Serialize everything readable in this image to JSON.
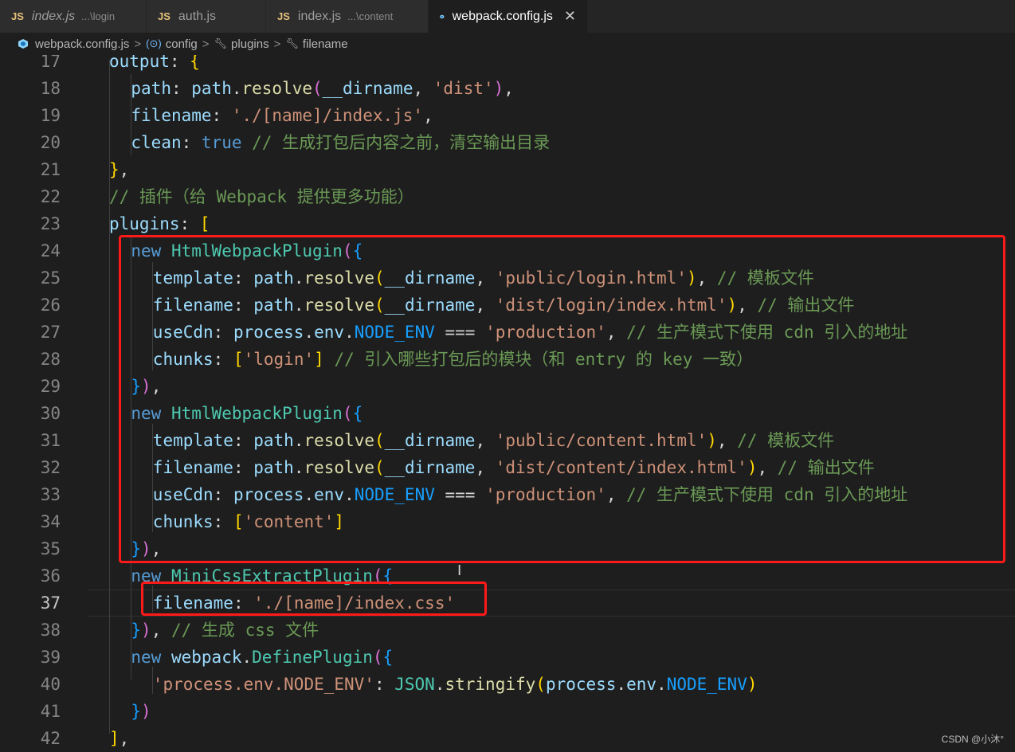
{
  "tabs": [
    {
      "name": "index.js",
      "hint": "...\\login",
      "italic": true
    },
    {
      "name": "auth.js",
      "hint": "",
      "italic": false
    },
    {
      "name": "index.js",
      "hint": "...\\content",
      "italic": false
    },
    {
      "name": "webpack.config.js",
      "hint": "",
      "italic": false,
      "active": true
    }
  ],
  "tab_badge": "JS",
  "close_glyph": "✕",
  "breadcrumb": [
    "webpack.config.js",
    "config",
    "plugins",
    "filename"
  ],
  "breadcrumb_sep": ">",
  "watermark": "CSDN @小沐°",
  "current_line": 37,
  "lines": [
    {
      "n": "17",
      "indent": 0,
      "t": [
        [
          "p",
          "output"
        ],
        [
          "pl",
          ": "
        ],
        [
          "b1",
          "{"
        ]
      ]
    },
    {
      "n": "18",
      "indent": 1,
      "t": [
        [
          "p",
          "path"
        ],
        [
          "pl",
          ": "
        ],
        [
          "p",
          "path"
        ],
        [
          "pl",
          "."
        ],
        [
          "f",
          "resolve"
        ],
        [
          "b2",
          "("
        ],
        [
          "p",
          "__dirname"
        ],
        [
          "pl",
          ", "
        ],
        [
          "s",
          "'dist'"
        ],
        [
          "b2",
          ")"
        ],
        [
          "pl",
          ","
        ]
      ]
    },
    {
      "n": "19",
      "indent": 1,
      "t": [
        [
          "p",
          "filename"
        ],
        [
          "pl",
          ": "
        ],
        [
          "s",
          "'./[name]/index.js'"
        ],
        [
          "pl",
          ","
        ]
      ]
    },
    {
      "n": "20",
      "indent": 1,
      "t": [
        [
          "p",
          "clean"
        ],
        [
          "pl",
          ": "
        ],
        [
          "k",
          "true"
        ],
        [
          "pl",
          " "
        ],
        [
          "cm",
          "// 生成打包后内容之前，清空输出目录"
        ]
      ]
    },
    {
      "n": "21",
      "indent": 0,
      "t": [
        [
          "b1",
          "}"
        ],
        [
          "pl",
          ","
        ]
      ]
    },
    {
      "n": "22",
      "indent": 0,
      "t": [
        [
          "cm",
          "// 插件（给 Webpack 提供更多功能）"
        ]
      ]
    },
    {
      "n": "23",
      "indent": 0,
      "t": [
        [
          "p",
          "plugins"
        ],
        [
          "pl",
          ": "
        ],
        [
          "b1",
          "["
        ]
      ]
    },
    {
      "n": "24",
      "indent": 1,
      "t": [
        [
          "k",
          "new"
        ],
        [
          "pl",
          " "
        ],
        [
          "c",
          "HtmlWebpackPlugin"
        ],
        [
          "b2",
          "("
        ],
        [
          "b3",
          "{"
        ]
      ]
    },
    {
      "n": "25",
      "indent": 2,
      "t": [
        [
          "p",
          "template"
        ],
        [
          "pl",
          ": "
        ],
        [
          "p",
          "path"
        ],
        [
          "pl",
          "."
        ],
        [
          "f",
          "resolve"
        ],
        [
          "b1",
          "("
        ],
        [
          "p",
          "__dirname"
        ],
        [
          "pl",
          ", "
        ],
        [
          "s",
          "'public/login.html'"
        ],
        [
          "b1",
          ")"
        ],
        [
          "pl",
          ", "
        ],
        [
          "cm",
          "// 模板文件"
        ]
      ]
    },
    {
      "n": "26",
      "indent": 2,
      "t": [
        [
          "p",
          "filename"
        ],
        [
          "pl",
          ": "
        ],
        [
          "p",
          "path"
        ],
        [
          "pl",
          "."
        ],
        [
          "f",
          "resolve"
        ],
        [
          "b1",
          "("
        ],
        [
          "p",
          "__dirname"
        ],
        [
          "pl",
          ", "
        ],
        [
          "s",
          "'dist/login/index.html'"
        ],
        [
          "b1",
          ")"
        ],
        [
          "pl",
          ", "
        ],
        [
          "cm",
          "// 输出文件"
        ]
      ]
    },
    {
      "n": "27",
      "indent": 2,
      "t": [
        [
          "p",
          "useCdn"
        ],
        [
          "pl",
          ": "
        ],
        [
          "p",
          "process"
        ],
        [
          "pl",
          "."
        ],
        [
          "p",
          "env"
        ],
        [
          "pl",
          "."
        ],
        [
          "b3",
          "NODE_ENV"
        ],
        [
          "pl",
          " === "
        ],
        [
          "s",
          "'production'"
        ],
        [
          "pl",
          ", "
        ],
        [
          "cm",
          "// 生产模式下使用 cdn 引入的地址"
        ]
      ]
    },
    {
      "n": "28",
      "indent": 2,
      "t": [
        [
          "p",
          "chunks"
        ],
        [
          "pl",
          ": "
        ],
        [
          "b1",
          "["
        ],
        [
          "s",
          "'login'"
        ],
        [
          "b1",
          "]"
        ],
        [
          "pl",
          " "
        ],
        [
          "cm",
          "// 引入哪些打包后的模块（和 entry 的 key 一致）"
        ]
      ]
    },
    {
      "n": "29",
      "indent": 1,
      "t": [
        [
          "b3",
          "}"
        ],
        [
          "b2",
          ")"
        ],
        [
          "pl",
          ","
        ]
      ]
    },
    {
      "n": "30",
      "indent": 1,
      "t": [
        [
          "k",
          "new"
        ],
        [
          "pl",
          " "
        ],
        [
          "c",
          "HtmlWebpackPlugin"
        ],
        [
          "b2",
          "("
        ],
        [
          "b3",
          "{"
        ]
      ]
    },
    {
      "n": "31",
      "indent": 2,
      "t": [
        [
          "p",
          "template"
        ],
        [
          "pl",
          ": "
        ],
        [
          "p",
          "path"
        ],
        [
          "pl",
          "."
        ],
        [
          "f",
          "resolve"
        ],
        [
          "b1",
          "("
        ],
        [
          "p",
          "__dirname"
        ],
        [
          "pl",
          ", "
        ],
        [
          "s",
          "'public/content.html'"
        ],
        [
          "b1",
          ")"
        ],
        [
          "pl",
          ", "
        ],
        [
          "cm",
          "// 模板文件"
        ]
      ]
    },
    {
      "n": "32",
      "indent": 2,
      "t": [
        [
          "p",
          "filename"
        ],
        [
          "pl",
          ": "
        ],
        [
          "p",
          "path"
        ],
        [
          "pl",
          "."
        ],
        [
          "f",
          "resolve"
        ],
        [
          "b1",
          "("
        ],
        [
          "p",
          "__dirname"
        ],
        [
          "pl",
          ", "
        ],
        [
          "s",
          "'dist/content/index.html'"
        ],
        [
          "b1",
          ")"
        ],
        [
          "pl",
          ", "
        ],
        [
          "cm",
          "// 输出文件"
        ]
      ]
    },
    {
      "n": "33",
      "indent": 2,
      "t": [
        [
          "p",
          "useCdn"
        ],
        [
          "pl",
          ": "
        ],
        [
          "p",
          "process"
        ],
        [
          "pl",
          "."
        ],
        [
          "p",
          "env"
        ],
        [
          "pl",
          "."
        ],
        [
          "b3",
          "NODE_ENV"
        ],
        [
          "pl",
          " === "
        ],
        [
          "s",
          "'production'"
        ],
        [
          "pl",
          ", "
        ],
        [
          "cm",
          "// 生产模式下使用 cdn 引入的地址"
        ]
      ]
    },
    {
      "n": "34",
      "indent": 2,
      "t": [
        [
          "p",
          "chunks"
        ],
        [
          "pl",
          ": "
        ],
        [
          "b1",
          "["
        ],
        [
          "s",
          "'content'"
        ],
        [
          "b1",
          "]"
        ]
      ]
    },
    {
      "n": "35",
      "indent": 1,
      "t": [
        [
          "b3",
          "}"
        ],
        [
          "b2",
          ")"
        ],
        [
          "pl",
          ","
        ]
      ]
    },
    {
      "n": "36",
      "indent": 1,
      "t": [
        [
          "k",
          "new"
        ],
        [
          "pl",
          " "
        ],
        [
          "c",
          "MiniCssExtractPlugin"
        ],
        [
          "b2",
          "("
        ],
        [
          "b3",
          "{"
        ]
      ]
    },
    {
      "n": "37",
      "indent": 2,
      "t": [
        [
          "p",
          "filename"
        ],
        [
          "pl",
          ": "
        ],
        [
          "s",
          "'./[name]/index.css'"
        ]
      ]
    },
    {
      "n": "38",
      "indent": 1,
      "t": [
        [
          "b3",
          "}"
        ],
        [
          "b2",
          ")"
        ],
        [
          "pl",
          ", "
        ],
        [
          "cm",
          "// 生成 css 文件"
        ]
      ]
    },
    {
      "n": "39",
      "indent": 1,
      "t": [
        [
          "k",
          "new"
        ],
        [
          "pl",
          " "
        ],
        [
          "p",
          "webpack"
        ],
        [
          "pl",
          "."
        ],
        [
          "c",
          "DefinePlugin"
        ],
        [
          "b2",
          "("
        ],
        [
          "b3",
          "{"
        ]
      ]
    },
    {
      "n": "40",
      "indent": 2,
      "t": [
        [
          "s",
          "'process.env.NODE_ENV'"
        ],
        [
          "pl",
          ": "
        ],
        [
          "c",
          "JSON"
        ],
        [
          "pl",
          "."
        ],
        [
          "f",
          "stringify"
        ],
        [
          "b1",
          "("
        ],
        [
          "p",
          "process"
        ],
        [
          "pl",
          "."
        ],
        [
          "p",
          "env"
        ],
        [
          "pl",
          "."
        ],
        [
          "b3",
          "NODE_ENV"
        ],
        [
          "b1",
          ")"
        ]
      ]
    },
    {
      "n": "41",
      "indent": 1,
      "t": [
        [
          "b3",
          "}"
        ],
        [
          "b2",
          ")"
        ]
      ]
    },
    {
      "n": "42",
      "indent": 0,
      "t": [
        [
          "b1",
          "]"
        ],
        [
          "pl",
          ","
        ]
      ]
    }
  ]
}
